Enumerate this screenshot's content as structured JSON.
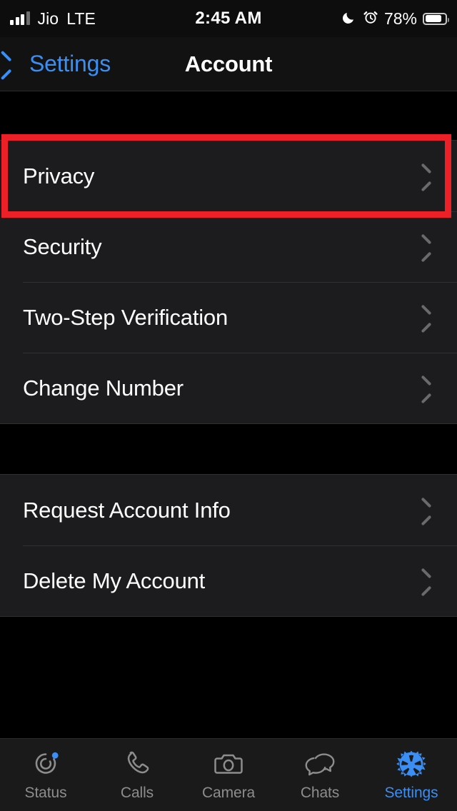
{
  "status_bar": {
    "carrier": "Jio",
    "network": "LTE",
    "time": "2:45 AM",
    "battery_percent": "78%",
    "icons": [
      "signal-bars-icon",
      "moon-icon",
      "alarm-clock-icon",
      "battery-icon"
    ]
  },
  "nav_bar": {
    "back_label": "Settings",
    "title": "Account",
    "back_icon": "chevron-left-icon",
    "accent_color": "#3b8ef3"
  },
  "highlight": {
    "color": "#ee2027",
    "target": "Privacy"
  },
  "groups": [
    {
      "rows": [
        {
          "label": "Privacy",
          "accessory": "chevron-right-icon",
          "highlighted": true
        },
        {
          "label": "Security",
          "accessory": "chevron-right-icon",
          "highlighted": false
        },
        {
          "label": "Two-Step Verification",
          "accessory": "chevron-right-icon",
          "highlighted": false
        },
        {
          "label": "Change Number",
          "accessory": "chevron-right-icon",
          "highlighted": false
        }
      ]
    },
    {
      "rows": [
        {
          "label": "Request Account Info",
          "accessory": "chevron-right-icon",
          "highlighted": false
        },
        {
          "label": "Delete My Account",
          "accessory": "chevron-right-icon",
          "highlighted": false
        }
      ]
    }
  ],
  "tab_bar": {
    "active": "Settings",
    "tabs": [
      {
        "label": "Status",
        "icon": "status-rings-icon",
        "badge": true
      },
      {
        "label": "Calls",
        "icon": "phone-icon",
        "badge": false
      },
      {
        "label": "Camera",
        "icon": "camera-icon",
        "badge": false
      },
      {
        "label": "Chats",
        "icon": "chat-bubbles-icon",
        "badge": false
      },
      {
        "label": "Settings",
        "icon": "gear-icon",
        "badge": false
      }
    ]
  }
}
